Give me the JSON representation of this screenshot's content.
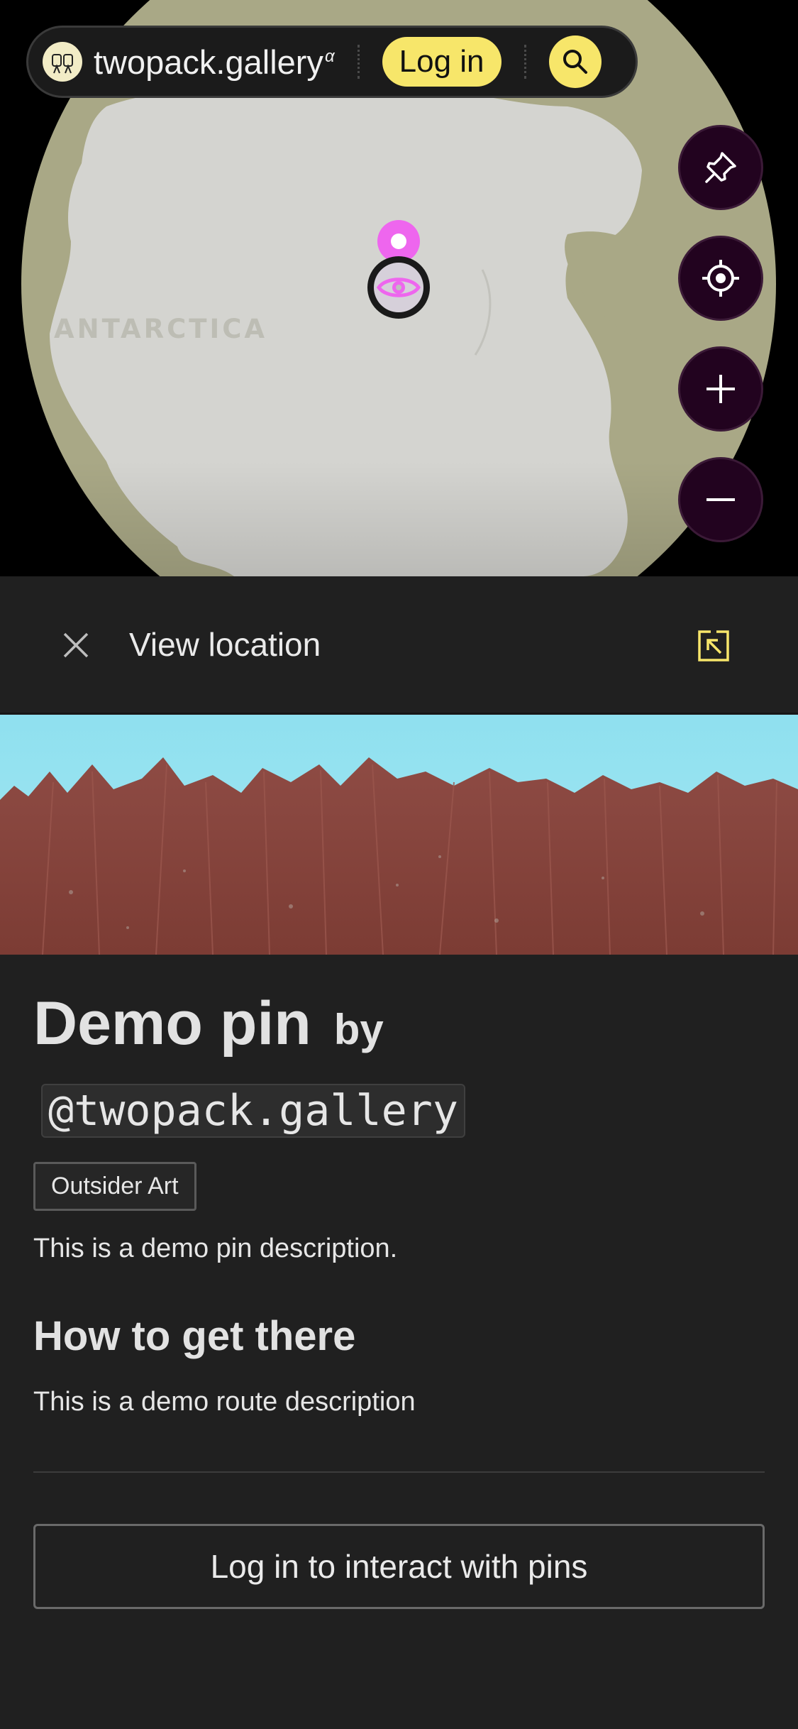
{
  "map": {
    "region_label": "ANTARCTICA",
    "colors": {
      "ocean": "#a9a886",
      "land": "#d4d4d0",
      "background": "#000000"
    }
  },
  "topbar": {
    "brand": "twopack.gallery",
    "brand_superscript": "α",
    "login_label": "Log in",
    "search_icon": "search-icon",
    "accent": "#f7e66a"
  },
  "controls": {
    "items": [
      {
        "icon": "pushpin-icon",
        "name": "add-pin-button"
      },
      {
        "icon": "crosshair-icon",
        "name": "locate-me-button"
      },
      {
        "icon": "plus-icon",
        "name": "zoom-in-button"
      },
      {
        "icon": "minus-icon",
        "name": "zoom-out-button"
      }
    ],
    "color": "#22031f"
  },
  "marker": {
    "icon": "eye-icon",
    "color": "#ee66ee"
  },
  "panel": {
    "header_title": "View location",
    "close_icon": "close-icon",
    "expand_icon": "expand-arrow-icon",
    "pin": {
      "title": "Demo pin",
      "by": "by",
      "handle": "@twopack.gallery",
      "tag": "Outsider Art",
      "description": "This is a demo pin description.",
      "route_heading": "How to get there",
      "route_description": "This is a demo route description"
    },
    "cta_label": "Log in to interact with pins"
  }
}
